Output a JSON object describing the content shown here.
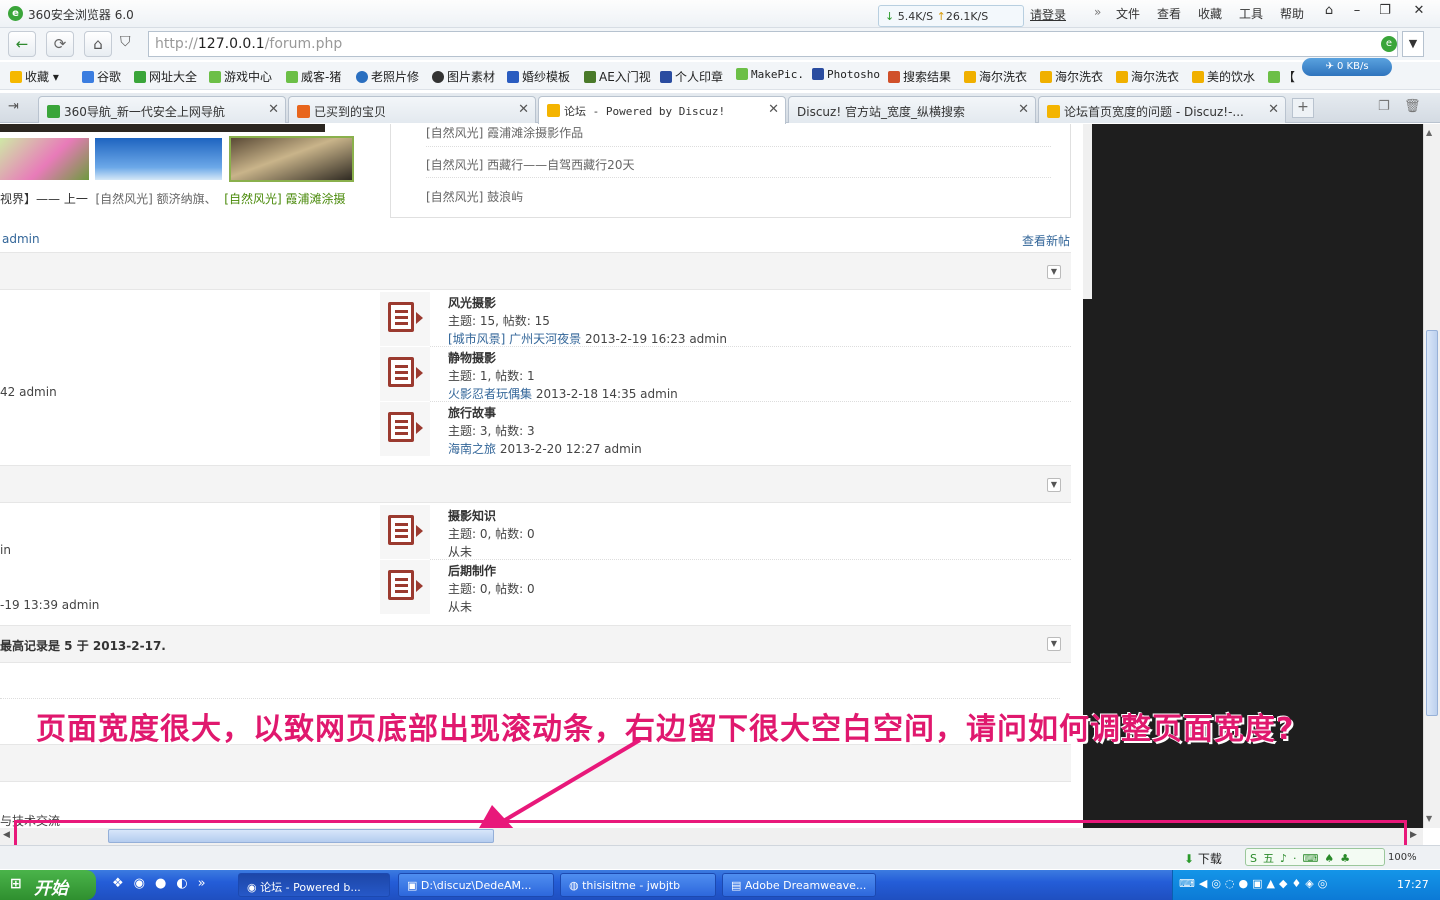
{
  "browser": {
    "title": "360安全浏览器 6.0",
    "speed_down": "5.4K/S",
    "speed_up": "26.1K/S",
    "login": "请登录",
    "menu": [
      "文件",
      "查看",
      "收藏",
      "工具",
      "帮助"
    ],
    "url_prefix": "http://",
    "url_host": "127.0.0.1",
    "url_path": "/forum.php",
    "kbs": "0 KB/s"
  },
  "favorites": [
    "收藏",
    "谷歌",
    "网址大全",
    "游戏中心",
    "威客-猪",
    "老照片修",
    "图片素材",
    "婚纱模板",
    "AE入门视",
    "个人印章",
    "MakePic.",
    "Photosho",
    "搜索结果",
    "海尔洗衣",
    "海尔洗衣",
    "海尔洗衣",
    "美的饮水",
    "【"
  ],
  "tabs": [
    {
      "label": "360导航_新一代安全上网导航",
      "color": "#3aa53a"
    },
    {
      "label": "已买到的宝贝",
      "color": "#e8651c"
    },
    {
      "label": "论坛 - Powered by Discuz!",
      "color": "#f4b400"
    },
    {
      "label": "Discuz! 官方站_宽度_纵横搜索",
      "color": "#ffffff"
    },
    {
      "label": "论坛首页宽度的问题 - Discuz!-...",
      "color": "#f4b400"
    }
  ],
  "page": {
    "slide_caption_cut": "视界】—— 上一",
    "slide_caption_1": "[自然风光] 额济纳旗、",
    "slide_caption_2": "[自然风光] 霞浦滩涂摄",
    "news": [
      "[自然风光] 霞浦滩涂摄影作品",
      "[自然风光] 西藏行——自驾西藏行20天",
      "[自然风光] 鼓浪屿"
    ],
    "admin_link": "admin",
    "view_new": "查看新帖",
    "forums_group1": [
      {
        "name": "风光摄影",
        "stat": "主题: 15, 帖数: 15",
        "last_link": "[城市风景] 广州天河夜景",
        "last_time": "2013-2-19 16:23 admin",
        "left_cut": ""
      },
      {
        "name": "静物摄影",
        "stat": "主题: 1, 帖数: 1",
        "last_link": "火影忍者玩偶集",
        "last_time": "2013-2-18 14:35 admin",
        "left_cut": "42 admin"
      },
      {
        "name": "旅行故事",
        "stat": "主题: 3, 帖数: 3",
        "last_link": "海南之旅",
        "last_time": "2013-2-20 12:27 admin",
        "left_cut": ""
      }
    ],
    "forums_group2": [
      {
        "name": "摄影知识",
        "stat": "主题: 0, 帖数: 0",
        "last": "从未",
        "left_cut": "in"
      },
      {
        "name": "后期制作",
        "stat": "主题: 0, 帖数: 0",
        "last": "从未",
        "left_cut": "-19 13:39 admin"
      }
    ],
    "record_text": "最高记录是 5 于 2013-2-17.",
    "footer_cut": "与技术交流"
  },
  "annotation": "页面宽度很大，以致网页底部出现滚动条，右边留下很大空白空间，请问如何调整页面宽度?",
  "status": {
    "download": "下载",
    "zoom": "100%"
  },
  "taskbar": {
    "start": "开始",
    "tasks": [
      "论坛 - Powered b...",
      "D:\\discuz\\DedeAM...",
      "thisisitme - jwbjtb",
      "Adobe Dreamweave..."
    ],
    "time": "17:27"
  }
}
